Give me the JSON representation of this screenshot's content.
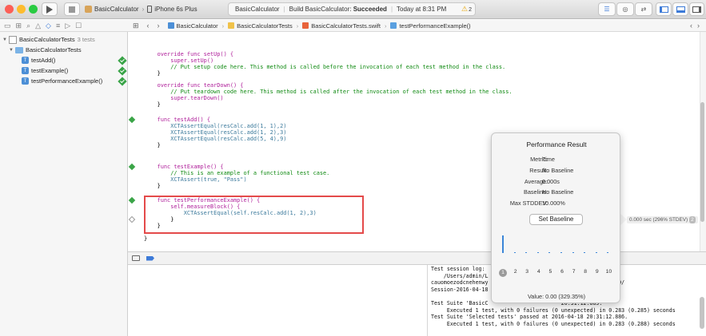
{
  "window": {
    "scheme_name": "BasicCalculator",
    "device": "iPhone 6s Plus",
    "status_project": "BasicCalculator",
    "status_build_prefix": "Build BasicCalculator:",
    "status_build_result": "Succeeded",
    "status_time": "Today at 8:31 PM",
    "warning_count": "2"
  },
  "navigator": {
    "items": [
      {
        "label": "BasicCalculatorTests",
        "detail": "3 tests"
      },
      {
        "label": "BasicCalculatorTests"
      },
      {
        "label": "testAdd()"
      },
      {
        "label": "testExample()"
      },
      {
        "label": "testPerformanceExample()"
      }
    ]
  },
  "jumpbar": {
    "crumbs": [
      "BasicCalculator",
      "BasicCalculatorTests",
      "BasicCalculatorTests.swift",
      "testPerformanceExample()"
    ]
  },
  "editor": {
    "lines": {
      "setup_sig": "    override func setUp() {",
      "setup_super": "        super.setUp()",
      "setup_comment": "        // Put setup code here. This method is called before the invocation of each test method in the class.",
      "teardown_sig": "    override func tearDown() {",
      "teardown_comment": "        // Put teardown code here. This method is called after the invocation of each test method in the class.",
      "teardown_super": "        super.tearDown()",
      "testadd_sig": "    func testAdd() {",
      "assert1": "        XCTAssertEqual(resCalc.add(1, 1),2)",
      "assert2": "        XCTAssertEqual(resCalc.add(1, 2),3)",
      "assert3": "        XCTAssertEqual(resCalc.add(5, 4),9)",
      "testexample_sig": "    func testExample() {",
      "example_comment": "        // This is an example of a functional test case.",
      "example_assert": "        XCTAssert(true, \"Pass\")",
      "perf_sig": "    func testPerformanceExample() {",
      "perf_measure": "        self.measureBlock() {",
      "perf_assert": "            XCTAssertEqual(self.resCalc.add(1, 2),3)",
      "perf_inner_close": "        }",
      "close_brace": "    }",
      "class_close": "}"
    }
  },
  "performance": {
    "title": "Performance Result",
    "metric_label": "Metric:",
    "metric_value": "Time",
    "result_label": "Result:",
    "result_value": "No Baseline",
    "average_label": "Average:",
    "average_value": "0.000s",
    "baseline_label": "Baseline:",
    "baseline_value": "No Baseline",
    "stddev_label": "Max STDDEV:",
    "stddev_value": "10.000%",
    "set_baseline": "Set Baseline",
    "iterations": [
      "1",
      "2",
      "3",
      "4",
      "5",
      "6",
      "7",
      "8",
      "9",
      "10"
    ],
    "iteration_values": [
      1.0,
      0.05,
      0.05,
      0.05,
      0.05,
      0.05,
      0.05,
      0.05,
      0.05,
      0.05
    ],
    "value_text": "Value:  0.00 (329.35%)",
    "inline_result": "0.000 sec (296% STDEV)",
    "inline_badge": "2"
  },
  "console": {
    "text": "Test session log:\n    /Users/admin/L                     BasicCalculator-\ncauomoezodcnehenwy                      0D-8E72-C21D58C8964D/\nSession-2016-04-18\n\nTest Suite 'BasicC                       20:31:12.885.\n     Executed 1 test, with 0 failures (0 unexpected) in 0.283 (0.285) seconds\nTest Suite 'Selected tests' passed at 2016-04-18 20:31:12.886.\n     Executed 1 test, with 0 failures (0 unexpected) in 0.283 (0.288) seconds"
  },
  "colors": {
    "success": "#39a347",
    "highlight_border": "#e44a4a",
    "accent": "#3b86d8"
  }
}
